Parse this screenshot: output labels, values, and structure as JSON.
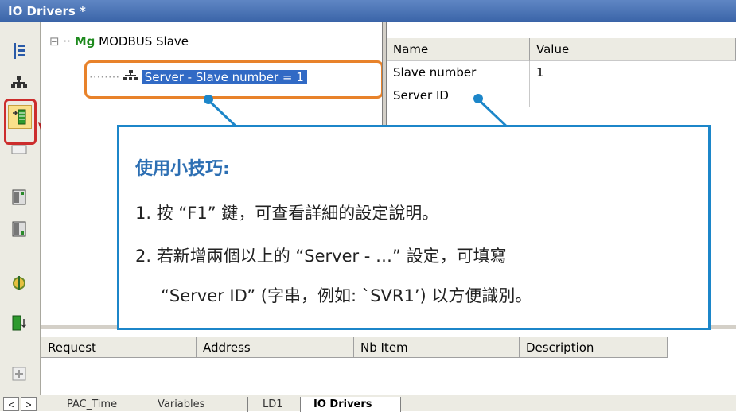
{
  "window": {
    "title": "IO Drivers *"
  },
  "toolbar": {
    "icons": [
      "tree-view-icon",
      "network-icon",
      "insert-server-icon",
      "remove-icon",
      "move-up-icon",
      "move-down-icon",
      "split-icon",
      "sort-icon",
      "add-row-icon"
    ]
  },
  "tree": {
    "root": {
      "expand_glyph": "⊟",
      "prefix": "Mg",
      "label": "MODBUS Slave"
    },
    "child": {
      "label": "Server - Slave number = 1"
    }
  },
  "properties": {
    "headers": {
      "name": "Name",
      "value": "Value"
    },
    "rows": [
      {
        "name": "Slave number",
        "value": "1"
      },
      {
        "name": "Server ID",
        "value": ""
      }
    ]
  },
  "requests": {
    "headers": [
      "Request",
      "Address",
      "Nb Item",
      "Description"
    ]
  },
  "tabs": {
    "nav_prev": "<",
    "nav_next": ">",
    "items": [
      {
        "label": "PAC_Time",
        "active": false
      },
      {
        "label": "Variables",
        "active": false
      },
      {
        "label": "LD1",
        "active": false
      },
      {
        "label": "IO Drivers",
        "active": true
      }
    ]
  },
  "callout": {
    "title": "使用小技巧:",
    "line1": "1.  按 “F1” 鍵，可查看詳細的設定說明。",
    "line2": "2.  若新增兩個以上的 “Server - …” 設定，可填寫",
    "line3": "“Server ID” (字串，例如: `SVR1’)  以方便識別。"
  },
  "colors": {
    "titlebar": "#3a64a8",
    "selection": "#316ac5",
    "callout_border": "#1c86c9",
    "callout_title": "#2d6fb3",
    "highlight_orange": "#e8822a",
    "highlight_red": "#cc2d2d"
  }
}
